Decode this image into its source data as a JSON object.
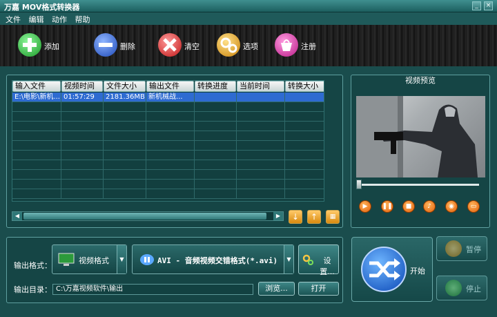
{
  "window": {
    "title": "万嘉 MOV格式转换器"
  },
  "menu": [
    "文件",
    "编辑",
    "动作",
    "帮助"
  ],
  "toolbar": [
    {
      "label": "添加",
      "icon": "add-shield-icon",
      "color": "#2fbf3a"
    },
    {
      "label": "删除",
      "icon": "remove-shield-icon",
      "color": "#2f66d9"
    },
    {
      "label": "清空",
      "icon": "clear-shield-icon",
      "color": "#d92a2a"
    },
    {
      "label": "选项",
      "icon": "options-gear-icon",
      "color": "#e2a21f"
    },
    {
      "label": "注册",
      "icon": "register-basket-icon",
      "color": "#d83aa7"
    }
  ],
  "file_list": {
    "columns": [
      "输入文件",
      "视频时间",
      "文件大小",
      "输出文件",
      "转换进度",
      "当前时间",
      "转换大小"
    ],
    "rows": [
      [
        "E:\\电影\\新机...",
        "01:57:29",
        "2181.36MB",
        "新机械战...",
        "",
        "",
        ""
      ]
    ]
  },
  "preview": {
    "title": "视频预览"
  },
  "output": {
    "format_label": "输出格式：",
    "category": "视频格式",
    "format": "AVI - 音频视频交错格式(*.avi)",
    "settings_label": "设置...",
    "dir_label": "输出目录：",
    "dir_value": "C:\\万嘉视频软件\\输出",
    "browse_label": "浏览...",
    "open_label": "打开"
  },
  "actions": {
    "start": "开始",
    "pause": "暂停",
    "stop": "停止"
  },
  "colors": {
    "accent": "#2e6bd1",
    "frame": "#1a4d4d",
    "control_orange": "#e3600a"
  }
}
